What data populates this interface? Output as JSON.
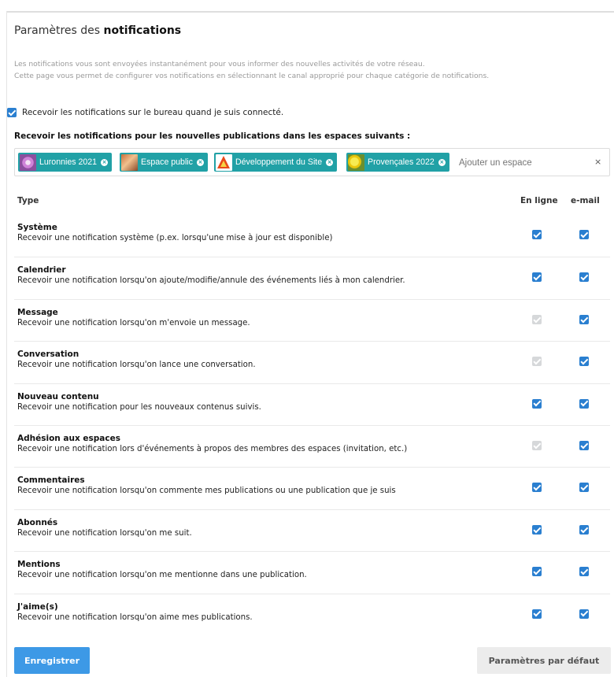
{
  "header": {
    "title_prefix": "Paramètres des ",
    "title_bold": "notifications",
    "intro_line1": "Les notifications vous sont envoyées instantanément pour vous informer des nouvelles activités de votre réseau.",
    "intro_line2": "Cette page vous permet de configurer vos notifications en sélectionnant le canal approprié pour chaque catégorie de notifications."
  },
  "desktop": {
    "label": "Recevoir les notifications sur le bureau quand je suis connecté.",
    "checked": true
  },
  "spaces": {
    "title": "Recevoir les notifications pour les nouvelles publications dans les espaces suivants :",
    "tags": [
      {
        "label": "Luronnies 2021",
        "icon": "flower-image"
      },
      {
        "label": "Espace public",
        "icon": "brown-abstract-image"
      },
      {
        "label": "Développement du Site",
        "icon": "construction-warning-image"
      },
      {
        "label": "Provençales 2022",
        "icon": "yellow-flower-image"
      }
    ],
    "input_placeholder": "Ajouter un espace",
    "clear_icon": "×",
    "accent_color": "#21a1a6"
  },
  "table": {
    "col_type": "Type",
    "col_web": "En ligne",
    "col_mail": "e-mail",
    "rows": [
      {
        "name": "Système",
        "desc": "Recevoir une notification système (p.ex. lorsqu'une mise à jour est disponible)",
        "web": true,
        "web_locked": false,
        "mail": true
      },
      {
        "name": "Calendrier",
        "desc": "Recevoir une notification lorsqu'on ajoute/modifie/annule des événements liés à mon calendrier.",
        "web": true,
        "web_locked": false,
        "mail": true
      },
      {
        "name": "Message",
        "desc": "Recevoir une notification lorsqu'on m'envoie un message.",
        "web": true,
        "web_locked": true,
        "mail": true
      },
      {
        "name": "Conversation",
        "desc": "Recevoir une notification lorsqu'on lance une conversation.",
        "web": true,
        "web_locked": true,
        "mail": true
      },
      {
        "name": "Nouveau contenu",
        "desc": "Recevoir une notification pour les nouveaux contenus suivis.",
        "web": true,
        "web_locked": false,
        "mail": true
      },
      {
        "name": "Adhésion aux espaces",
        "desc": "Recevoir une notification lors d'événements à propos des membres des espaces (invitation, etc.)",
        "web": true,
        "web_locked": true,
        "mail": true
      },
      {
        "name": "Commentaires",
        "desc": "Recevoir une notification lorsqu'on commente mes publications ou une publication que je suis",
        "web": true,
        "web_locked": false,
        "mail": true
      },
      {
        "name": "Abonnés",
        "desc": "Recevoir une notification lorsqu'on me suit.",
        "web": true,
        "web_locked": false,
        "mail": true
      },
      {
        "name": "Mentions",
        "desc": "Recevoir une notification lorsqu'on me mentionne dans une publication.",
        "web": true,
        "web_locked": false,
        "mail": true
      },
      {
        "name": "J'aime(s)",
        "desc": "Recevoir une notification lorsqu'on aime mes publications.",
        "web": true,
        "web_locked": false,
        "mail": true
      }
    ]
  },
  "buttons": {
    "save": "Enregistrer",
    "defaults": "Paramètres par défaut"
  },
  "colors": {
    "checkbox": "#2a7fd0",
    "checkbox_locked": "#d6d8da",
    "primary_button": "#3d99e6"
  }
}
